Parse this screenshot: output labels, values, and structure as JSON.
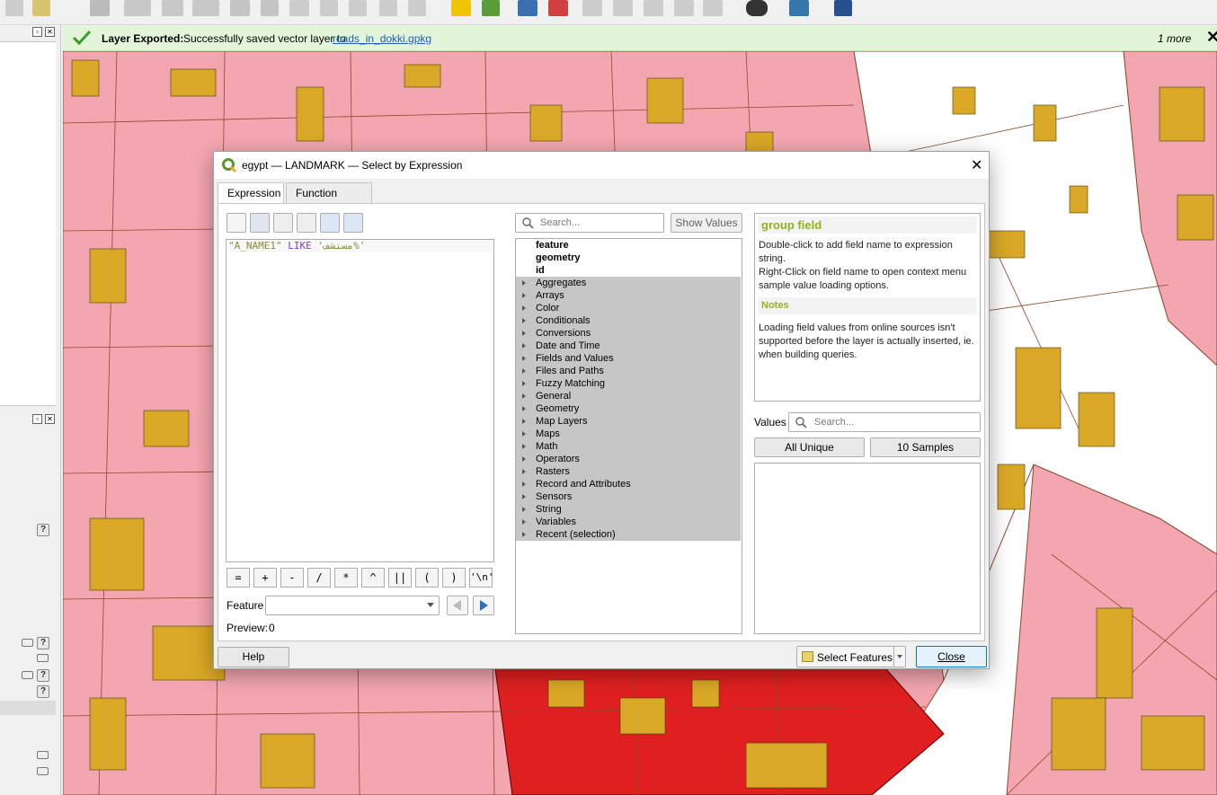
{
  "message_bar": {
    "title": "Layer Exported:",
    "text": "Successfully saved vector layer to",
    "link": "roads_in_dokki.gpkg",
    "more": "1 more"
  },
  "dialog": {
    "title": "egypt — LANDMARK — Select by Expression",
    "tabs": [
      "Expression",
      "Function Editor"
    ],
    "expression": {
      "field": "\"A_NAME1\"",
      "operator": "LIKE",
      "literal": "'مستشف%'"
    },
    "operators": [
      "=",
      "+",
      "-",
      "/",
      "*",
      "^",
      "||",
      "(",
      ")",
      "'\\n'"
    ],
    "feature_label": "Feature",
    "preview_label": "Preview:",
    "preview_value": "0",
    "search_placeholder": "Search...",
    "show_values": "Show Values",
    "tree": {
      "fields": [
        "feature",
        "geometry",
        "id"
      ],
      "groups": [
        "Aggregates",
        "Arrays",
        "Color",
        "Conditionals",
        "Conversions",
        "Date and Time",
        "Fields and Values",
        "Files and Paths",
        "Fuzzy Matching",
        "General",
        "Geometry",
        "Map Layers",
        "Maps",
        "Math",
        "Operators",
        "Rasters",
        "Record and Attributes",
        "Sensors",
        "String",
        "Variables",
        "Recent (selection)"
      ]
    },
    "help": {
      "heading": "group field",
      "p1": "Double-click to add field name to expression string.",
      "p2": "Right-Click on field name to open context menu sample value loading options.",
      "notes_heading": "Notes",
      "notes_text": "Loading field values from online sources isn't supported before the layer is actually inserted, ie. when building queries."
    },
    "values_label": "Values",
    "values_search_placeholder": "Search...",
    "all_unique": "All Unique",
    "samples": "10 Samples",
    "help_button": "Help",
    "select_features": "Select Features",
    "close_button": "Close"
  },
  "colors": {
    "map_pink": "#f4a6b0",
    "map_building": "#d9a826",
    "map_selected": "#e02020",
    "qgis_green": "#93b023"
  }
}
